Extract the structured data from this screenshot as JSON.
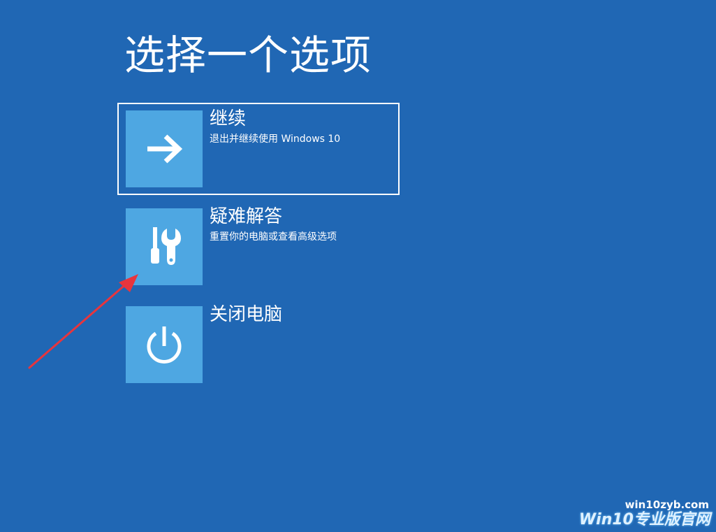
{
  "page_title": "选择一个选项",
  "options": [
    {
      "title": "继续",
      "description": "退出并继续使用 Windows 10",
      "icon": "arrow-right-icon",
      "selected": true
    },
    {
      "title": "疑难解答",
      "description": "重置你的电脑或查看高级选项",
      "icon": "tools-icon",
      "selected": false
    },
    {
      "title": "关闭电脑",
      "description": "",
      "icon": "power-icon",
      "selected": false
    }
  ],
  "watermark": {
    "url": "win10zyb.com",
    "brand": "Win10专业版官网"
  },
  "colors": {
    "background": "#2067b4",
    "tile": "#4ea7e2",
    "text": "#ffffff",
    "annotation_arrow": "#e8353d"
  }
}
